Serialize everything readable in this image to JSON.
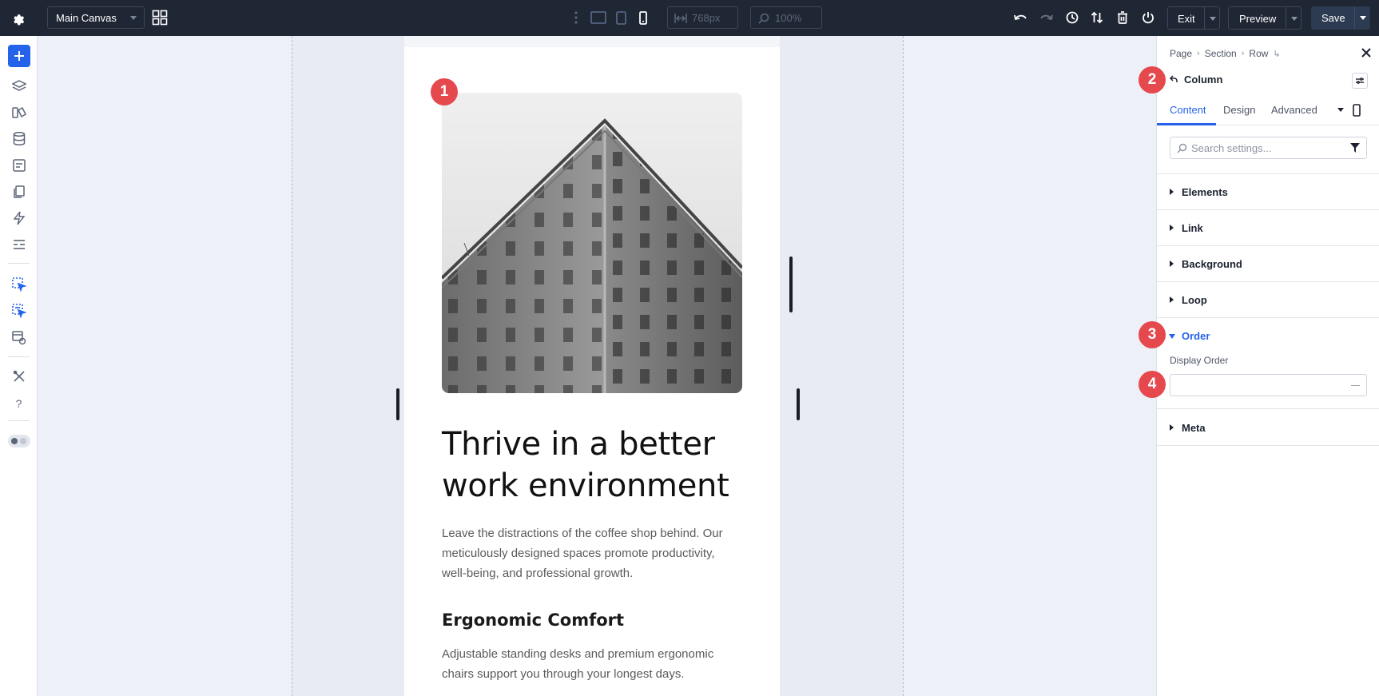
{
  "topbar": {
    "canvas_select": "Main Canvas",
    "width_value": "768px",
    "zoom_value": "100%",
    "exit_label": "Exit",
    "preview_label": "Preview",
    "save_label": "Save"
  },
  "canvas": {
    "hero_title": "Thrive in a better work environment",
    "hero_body": "Leave the distractions of the coffee shop behind. Our meticulously designed spaces promote productivity, well-being, and professional growth.",
    "sub_title": "Ergonomic Comfort",
    "sub_body": "Adjustable standing desks and premium ergonomic chairs support you through your longest days."
  },
  "markers": [
    "1",
    "2",
    "3",
    "4"
  ],
  "panel": {
    "breadcrumbs": [
      "Page",
      "Section",
      "Row"
    ],
    "title": "Column",
    "tabs": [
      "Content",
      "Design",
      "Advanced"
    ],
    "active_tab": "Content",
    "search_placeholder": "Search settings...",
    "sections": [
      "Elements",
      "Link",
      "Background",
      "Loop",
      "Order",
      "Meta"
    ],
    "open_section": "Order",
    "order_field_label": "Display Order",
    "order_field_value": ""
  },
  "colors": {
    "topbar_bg": "#1f2634",
    "accent": "#2563eb",
    "marker": "#e5484d"
  }
}
